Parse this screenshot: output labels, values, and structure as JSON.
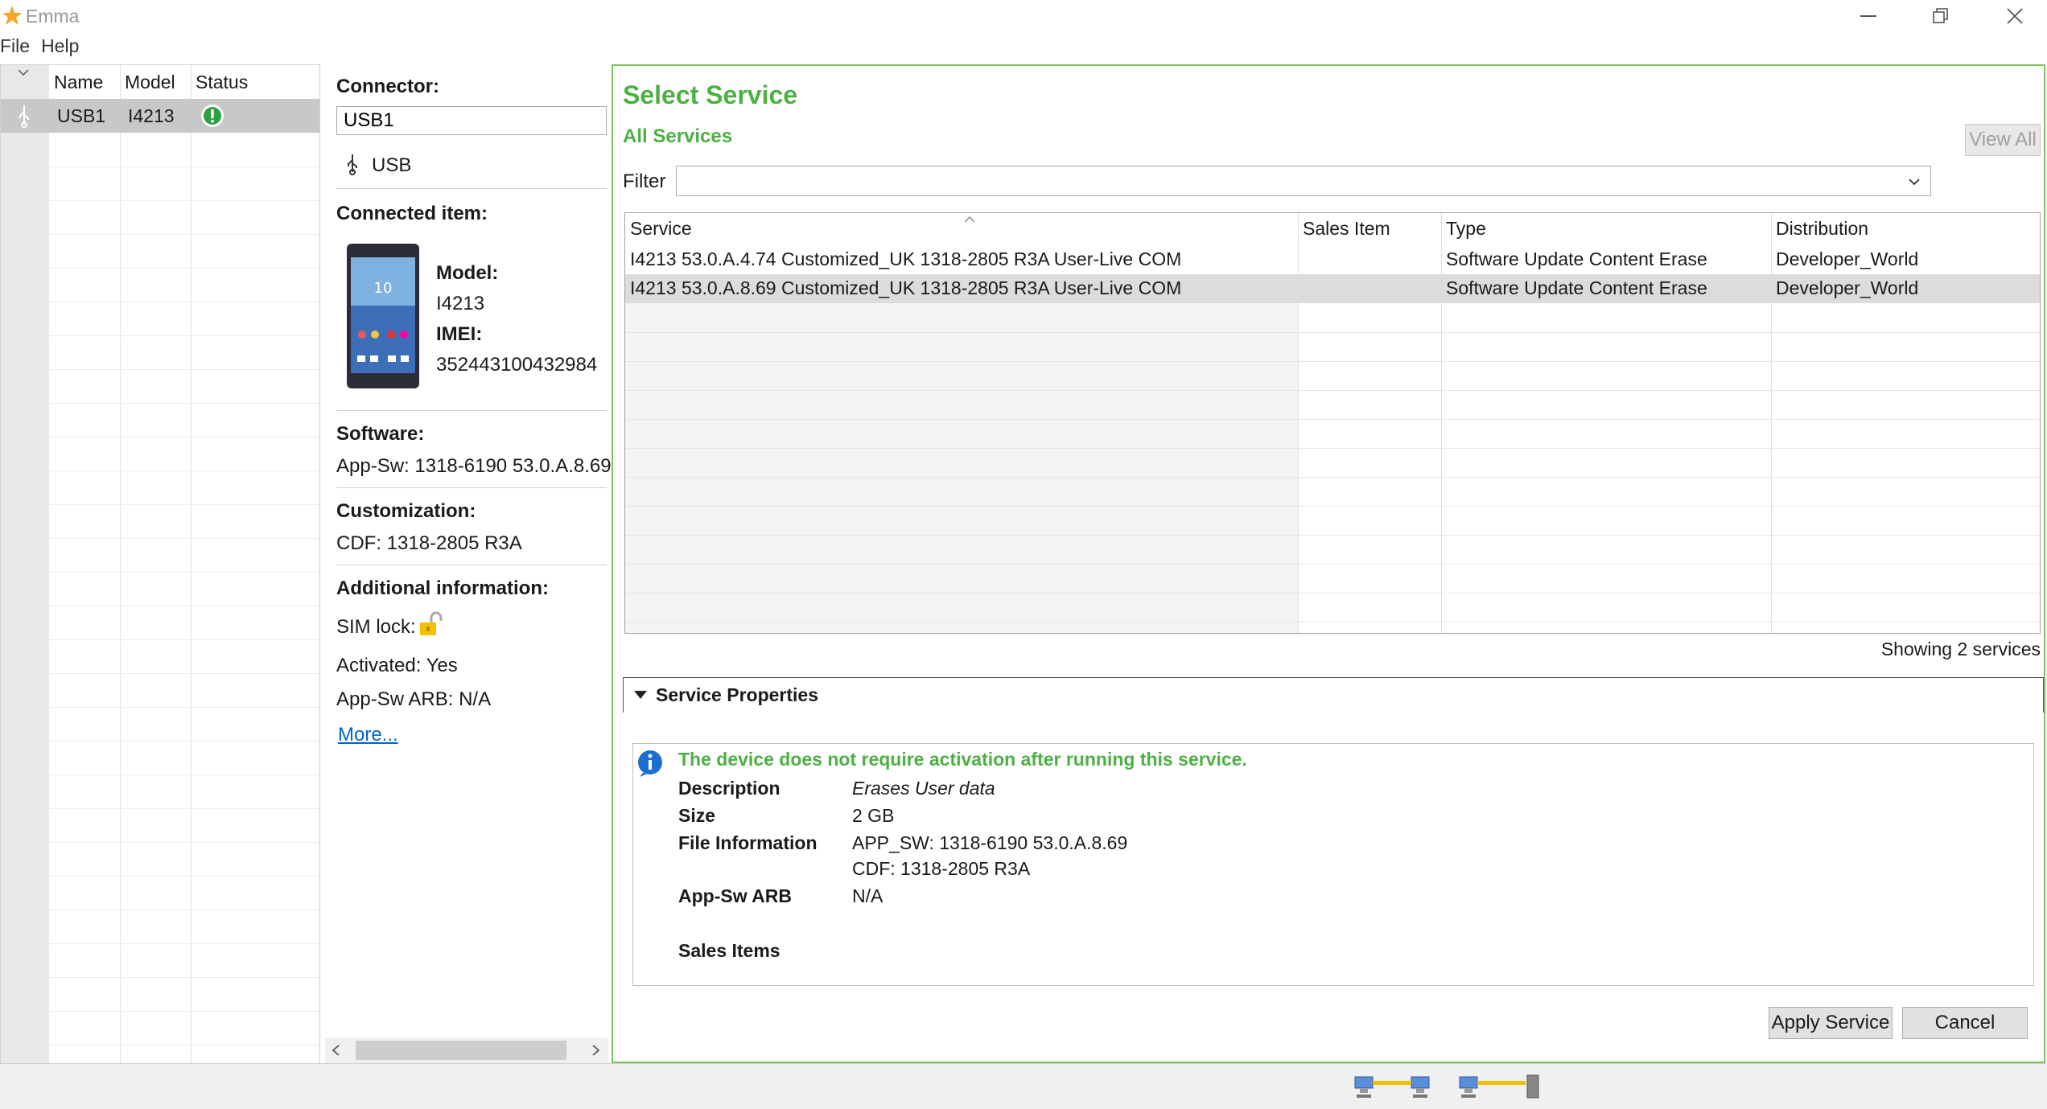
{
  "window": {
    "title": "Emma"
  },
  "menu": {
    "items": [
      "File",
      "Help"
    ]
  },
  "device_list": {
    "columns": [
      "Name",
      "Model",
      "Status"
    ],
    "rows": [
      {
        "name": "USB1",
        "model": "I4213",
        "status_icon": "exclamation-icon"
      }
    ]
  },
  "details": {
    "connector_label": "Connector:",
    "connector_value": "USB1",
    "connector_type": "USB",
    "connected_item_label": "Connected item:",
    "model_label": "Model:",
    "model_value": "I4213",
    "imei_label": "IMEI:",
    "imei_value": "352443100432984",
    "software_label": "Software:",
    "software_value": "App-Sw: 1318-6190 53.0.A.8.69",
    "customization_label": "Customization:",
    "customization_value": "CDF: 1318-2805 R3A",
    "additional_label": "Additional information:",
    "sim_lock_label": "SIM lock:",
    "activated": "Activated: Yes",
    "arb": "App-Sw ARB: N/A",
    "more_link": "More..."
  },
  "service": {
    "title": "Select Service",
    "subtitle": "All Services",
    "view_all": "View All",
    "filter_label": "Filter",
    "filter_value": "",
    "columns": [
      "Service",
      "Sales Item",
      "Type",
      "Distribution"
    ],
    "rows": [
      {
        "service": "I4213 53.0.A.4.74 Customized_UK 1318-2805 R3A User-Live COM",
        "sales_item": "",
        "type": "Software Update Content Erase",
        "distribution": "Developer_World"
      },
      {
        "service": "I4213 53.0.A.8.69 Customized_UK 1318-2805 R3A User-Live COM",
        "sales_item": "",
        "type": "Software Update Content Erase",
        "distribution": "Developer_World"
      }
    ],
    "count_text": "Showing 2 services"
  },
  "properties": {
    "header": "Service Properties",
    "notice": "The device does not require activation after running this service.",
    "description_label": "Description",
    "description_value": "Erases User data",
    "size_label": "Size",
    "size_value": "2 GB",
    "file_info_label": "File Information",
    "file_info_line1": "APP_SW: 1318-6190 53.0.A.8.69",
    "file_info_line2": "CDF: 1318-2805 R3A",
    "arb_label": "App-Sw ARB",
    "arb_value": "N/A",
    "sales_items_label": "Sales Items"
  },
  "actions": {
    "apply": "Apply Service",
    "cancel": "Cancel"
  },
  "colors": {
    "accent_green": "#4cb043",
    "border_green": "#7cc35a",
    "link_blue": "#0066cc"
  }
}
